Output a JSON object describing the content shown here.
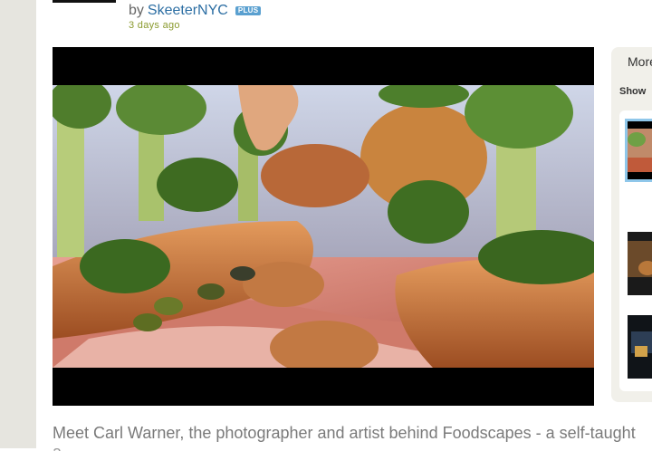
{
  "post": {
    "by_label": "by",
    "author": "SkeeterNYC",
    "badge": "PLUS",
    "posted": "3 days ago"
  },
  "video": {
    "scene": "foodscape-frame",
    "letterbox_color": "#000000"
  },
  "side_panel": {
    "more_tab": "More",
    "show_label": "Show"
  },
  "description": {
    "text": "Meet Carl Warner, the photographer and artist behind Foodscapes - a self-taught",
    "text_line2": "a..."
  },
  "colors": {
    "link": "#2c6ea3",
    "timestamp": "#8a9a2e",
    "badge": "#5aa0d0",
    "gutter": "#e6e5df"
  }
}
